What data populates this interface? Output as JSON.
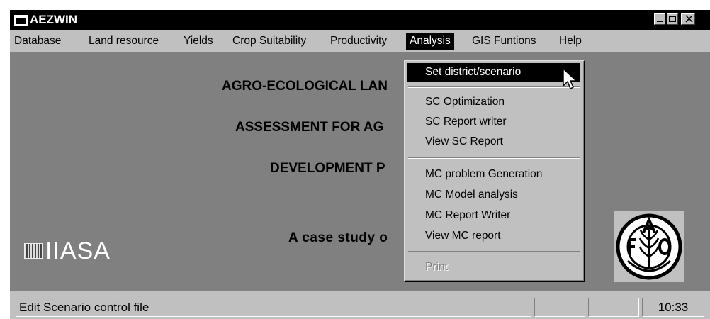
{
  "window": {
    "title": "AEZWIN"
  },
  "menubar": {
    "items": [
      {
        "label": "Database"
      },
      {
        "label": "Land resource"
      },
      {
        "label": "Yields"
      },
      {
        "label": "Crop Suitability"
      },
      {
        "label": "Productivity"
      },
      {
        "label": "Analysis",
        "active": true
      },
      {
        "label": "GIS Funtions"
      },
      {
        "label": "Help"
      }
    ]
  },
  "client": {
    "line1": "AGRO-ECOLOGICAL LAN",
    "line2": "ASSESSMENT FOR AG",
    "line3": "DEVELOPMENT P",
    "line4": "A case study o",
    "logo_left": "IIASA"
  },
  "dropdown": {
    "items": [
      {
        "label": "Set district/scenario",
        "selected": true
      },
      {
        "label": "SC Optimization"
      },
      {
        "label": "SC Report  writer"
      },
      {
        "label": "View SC Report"
      },
      {
        "label": "MC problem Generation"
      },
      {
        "label": "MC Model analysis"
      },
      {
        "label": "MC Report  Writer"
      },
      {
        "label": " View MC report"
      },
      {
        "label": "Print",
        "disabled": true
      }
    ]
  },
  "statusbar": {
    "message": "Edit Scenario control file",
    "clock": "10:33"
  },
  "icons": {
    "app": "window-icon",
    "cursor": "arrow-cursor-icon",
    "fao": "fao-logo-icon"
  },
  "colors": {
    "titlebar": "#000000",
    "menubar": "#c0c0c0",
    "client": "#808080",
    "highlight": "#000000"
  }
}
